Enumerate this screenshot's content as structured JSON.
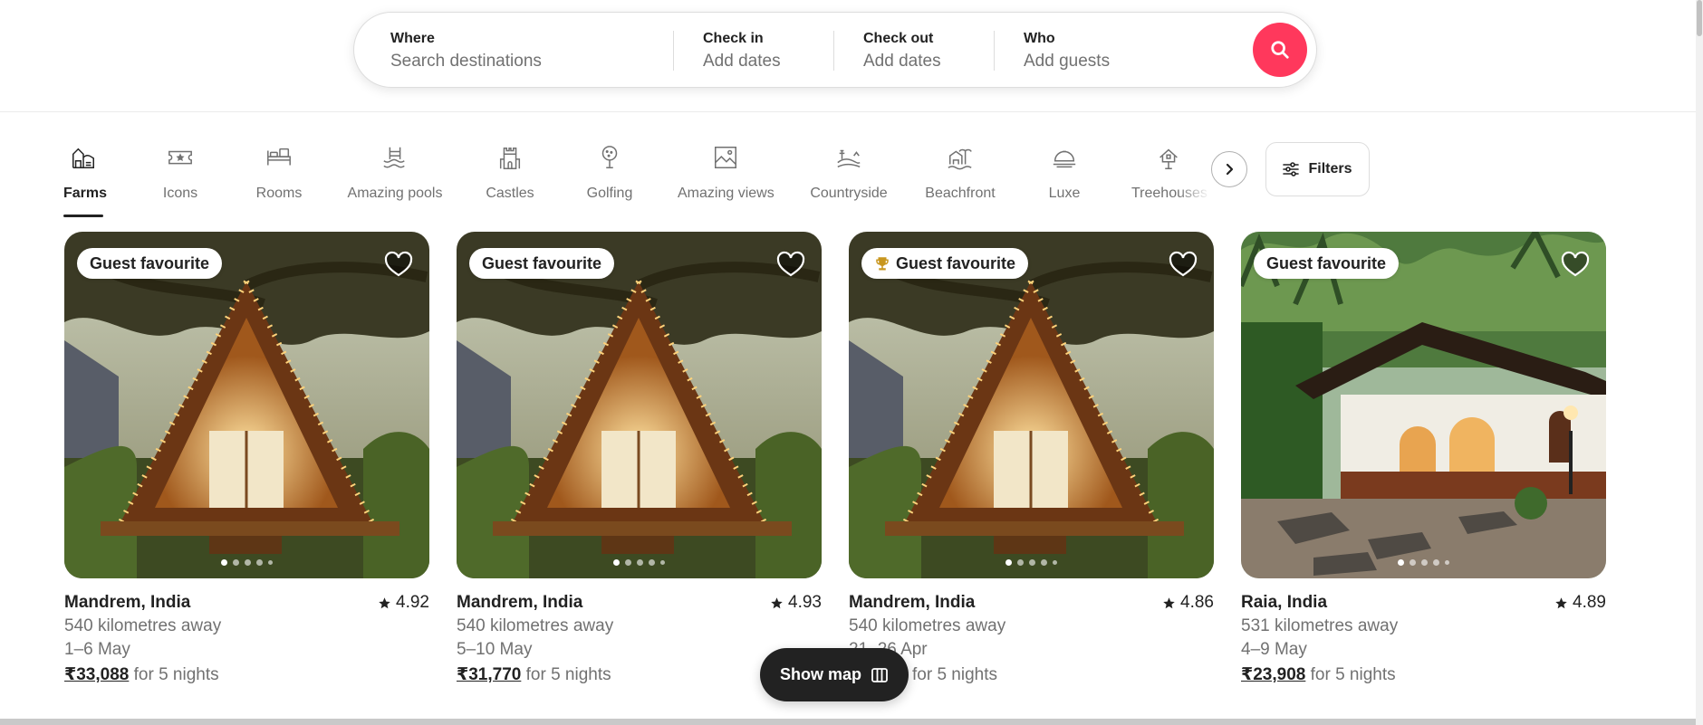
{
  "search": {
    "where_label": "Where",
    "where_placeholder": "Search destinations",
    "checkin_label": "Check in",
    "checkin_value": "Add dates",
    "checkout_label": "Check out",
    "checkout_value": "Add dates",
    "who_label": "Who",
    "who_value": "Add guests",
    "button_icon": "search-icon",
    "accent_color": "#ff385c"
  },
  "categories": [
    {
      "label": "Farms",
      "icon": "farm-icon",
      "active": true
    },
    {
      "label": "Icons",
      "icon": "ticket-star-icon",
      "active": false
    },
    {
      "label": "Rooms",
      "icon": "bed-icon",
      "active": false
    },
    {
      "label": "Amazing pools",
      "icon": "pool-icon",
      "active": false
    },
    {
      "label": "Castles",
      "icon": "castle-icon",
      "active": false
    },
    {
      "label": "Golfing",
      "icon": "golf-icon",
      "active": false
    },
    {
      "label": "Amazing views",
      "icon": "landscape-icon",
      "active": false
    },
    {
      "label": "Countryside",
      "icon": "countryside-icon",
      "active": false
    },
    {
      "label": "Beachfront",
      "icon": "beach-icon",
      "active": false
    },
    {
      "label": "Luxe",
      "icon": "cloche-icon",
      "active": false
    },
    {
      "label": "Treehouses",
      "icon": "treehouse-icon",
      "active": false
    }
  ],
  "filters": {
    "label": "Filters",
    "icon": "sliders-icon"
  },
  "listings": [
    {
      "badge": "Guest favourite",
      "trophy": false,
      "location": "Mandrem, India",
      "rating": "4.92",
      "distance": "540 kilometres away",
      "dates": "1–6 May",
      "price": "₹33,088",
      "price_suffix": "for 5 nights",
      "photo": "a-frame-cabin"
    },
    {
      "badge": "Guest favourite",
      "trophy": false,
      "location": "Mandrem, India",
      "rating": "4.93",
      "distance": "540 kilometres away",
      "dates": "5–10 May",
      "price": "₹31,770",
      "price_suffix": "for 5 nights",
      "photo": "a-frame-cabin"
    },
    {
      "badge": "Guest favourite",
      "trophy": true,
      "location": "Mandrem, India",
      "rating": "4.86",
      "distance": "540 kilometres away",
      "dates": "21–26 Apr",
      "price": "",
      "price_suffix": "for 5 nights",
      "photo": "a-frame-cabin"
    },
    {
      "badge": "Guest favourite",
      "trophy": false,
      "location": "Raia, India",
      "rating": "4.89",
      "distance": "531 kilometres away",
      "dates": "4–9 May",
      "price": "₹23,908",
      "price_suffix": "for 5 nights",
      "photo": "cottage"
    }
  ],
  "show_map": {
    "label": "Show map",
    "icon": "map-icon"
  }
}
